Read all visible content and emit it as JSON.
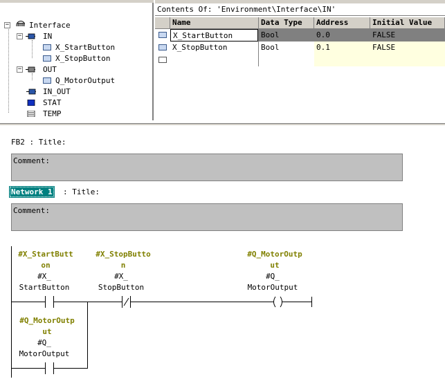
{
  "tree": {
    "root": "Interface",
    "items": [
      {
        "label": "IN"
      },
      {
        "label": "X_StartButton"
      },
      {
        "label": "X_StopButton"
      },
      {
        "label": "OUT"
      },
      {
        "label": "Q_MotorOutput"
      },
      {
        "label": "IN_OUT"
      },
      {
        "label": "STAT"
      },
      {
        "label": "TEMP"
      }
    ]
  },
  "contents": {
    "title": "Contents Of: 'Environment\\Interface\\IN'",
    "columns": [
      "Name",
      "Data Type",
      "Address",
      "Initial Value"
    ],
    "rows": [
      {
        "name": "X_StartButton",
        "type": "Bool",
        "address": "0.0",
        "initial": "FALSE"
      },
      {
        "name": "X_StopButton",
        "type": "Bool",
        "address": "0.1",
        "initial": "FALSE"
      }
    ]
  },
  "block": {
    "title": "FB2 : Title:",
    "comment_label": "Comment:"
  },
  "network": {
    "label": "Network 1",
    "title": ": Title:",
    "comment_label": "Comment:",
    "contacts": [
      {
        "sym1": "#X_StartButt",
        "sym2": "on",
        "op1": "#X_",
        "op2": "StartButton"
      },
      {
        "sym1": "#X_StopButto",
        "sym2": "n",
        "op1": "#X_",
        "op2": "StopButton"
      },
      {
        "sym1": "#Q_MotorOutp",
        "sym2": "ut",
        "op1": "#Q_",
        "op2": "MotorOutput"
      },
      {
        "sym1": "#Q_MotorOutp",
        "sym2": "ut",
        "op1": "#Q_",
        "op2": "MotorOutput"
      }
    ]
  },
  "colors": {
    "symbol": "#808000",
    "selection": "#008080",
    "comment_bg": "#c0c0c0"
  }
}
